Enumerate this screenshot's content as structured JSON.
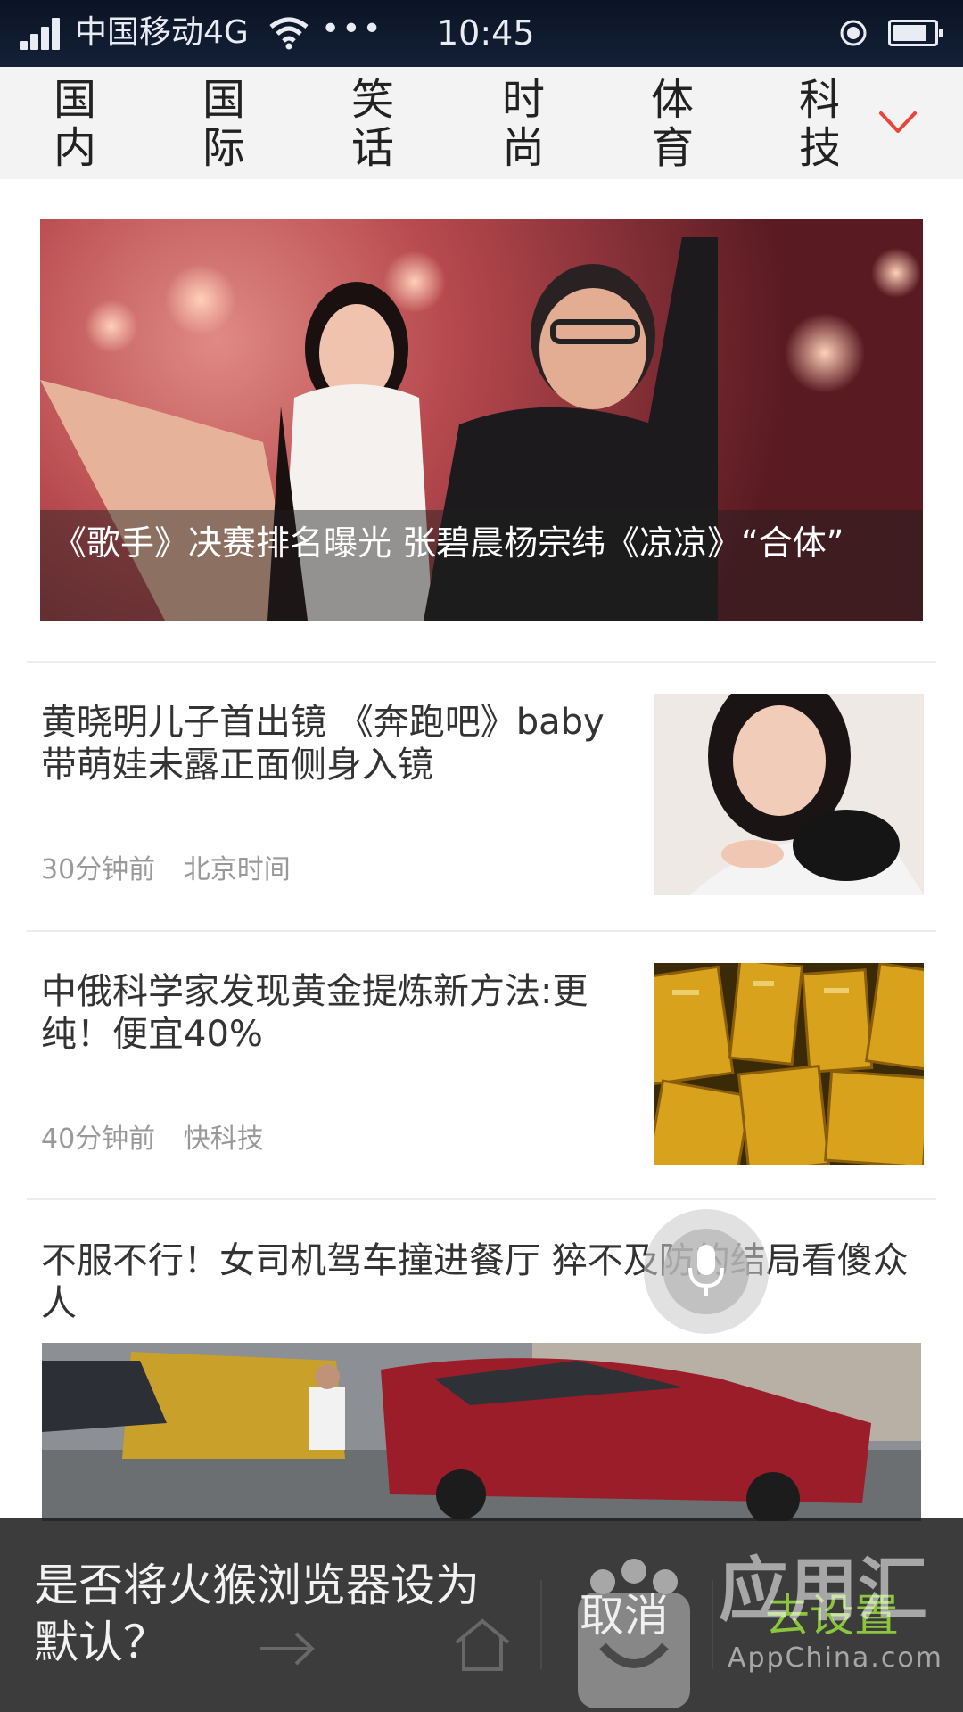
{
  "status_bar": {
    "carrier": "中国移动4G",
    "dots": "•••",
    "time": "10:45",
    "icons": [
      "signal-icon",
      "wifi-icon",
      "location-icon",
      "battery-icon"
    ],
    "battery_level": 0.85
  },
  "tabs": [
    {
      "label": "国内"
    },
    {
      "label": "国际"
    },
    {
      "label": "笑话"
    },
    {
      "label": "时尚"
    },
    {
      "label": "体育"
    },
    {
      "label": "科技"
    }
  ],
  "tabs_more_icon": "chevron-down-icon",
  "accent_color": "#e8453c",
  "hero": {
    "title": "《歌手》决赛排名曝光 张碧晨杨宗纬《凉凉》“合体”"
  },
  "news": [
    {
      "title": "黄晓明儿子首出镜 《奔跑吧》baby带萌娃未露正面侧身入镜",
      "time": "30分钟前",
      "source": "北京时间"
    },
    {
      "title": "中俄科学家发现黄金提炼新方法:更纯！便宜40%",
      "time": "40分钟前",
      "source": "快科技"
    },
    {
      "title": "不服不行！女司机驾车撞进餐厅 猝不及防的结局看傻众人"
    }
  ],
  "prompt": {
    "message": "是否将火猴浏览器设为默认？",
    "cancel": "取消",
    "confirm": "去设置",
    "confirm_color": "#8cc63e"
  },
  "watermark": {
    "cn": "应用汇",
    "en": "AppChina.com"
  }
}
